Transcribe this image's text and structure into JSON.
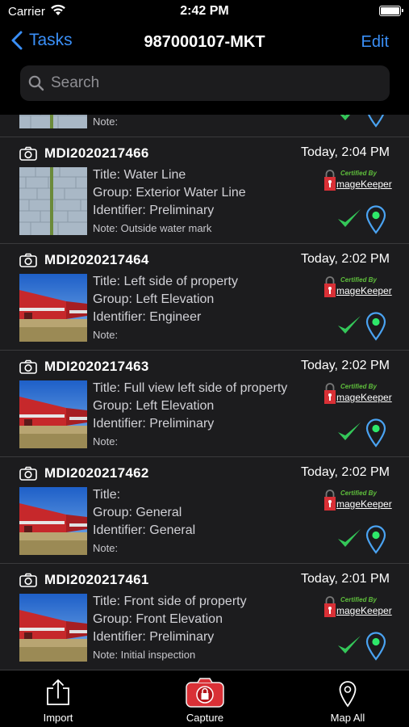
{
  "status": {
    "carrier": "Carrier",
    "time": "2:42 PM"
  },
  "nav": {
    "back_label": "Tasks",
    "title": "987000107-MKT",
    "edit_label": "Edit"
  },
  "search": {
    "placeholder": "Search"
  },
  "list": {
    "partial_note": "Note:",
    "items": [
      {
        "id": "MDI2020217466",
        "date": "Today, 2:04 PM",
        "title": "Title: Water Line",
        "group": "Group: Exterior Water Line",
        "identifier": "Identifier: Preliminary",
        "note": "Note: Outside water mark",
        "thumb": "wall"
      },
      {
        "id": "MDI2020217464",
        "date": "Today, 2:02 PM",
        "title": "Title: Left side of property",
        "group": "Group: Left Elevation",
        "identifier": "Identifier: Engineer",
        "note": "Note:",
        "thumb": "barn"
      },
      {
        "id": "MDI2020217463",
        "date": "Today, 2:02 PM",
        "title": "Title: Full view left side of property",
        "group": "Group: Left Elevation",
        "identifier": "Identifier: Preliminary",
        "note": "Note:",
        "thumb": "barn"
      },
      {
        "id": "MDI2020217462",
        "date": "Today, 2:02 PM",
        "title": "Title:",
        "group": "Group: General",
        "identifier": "Identifier: General",
        "note": "Note:",
        "thumb": "barn"
      },
      {
        "id": "MDI2020217461",
        "date": "Today, 2:01 PM",
        "title": "Title: Front side of property",
        "group": "Group: Front Elevation",
        "identifier": "Identifier: Preliminary",
        "note": "Note: Initial inspection",
        "thumb": "barn"
      }
    ]
  },
  "cert_badge": {
    "top": "Certified By",
    "brand": "mageKeeper"
  },
  "tabbar": {
    "import_label": "Import",
    "capture_label": "Capture",
    "map_label": "Map All"
  },
  "colors": {
    "accent": "#3a8ff7",
    "check": "#34c759",
    "pin_dot": "#2ee86a",
    "capture_red": "#d93036",
    "brand_green": "#5fbf3c"
  }
}
